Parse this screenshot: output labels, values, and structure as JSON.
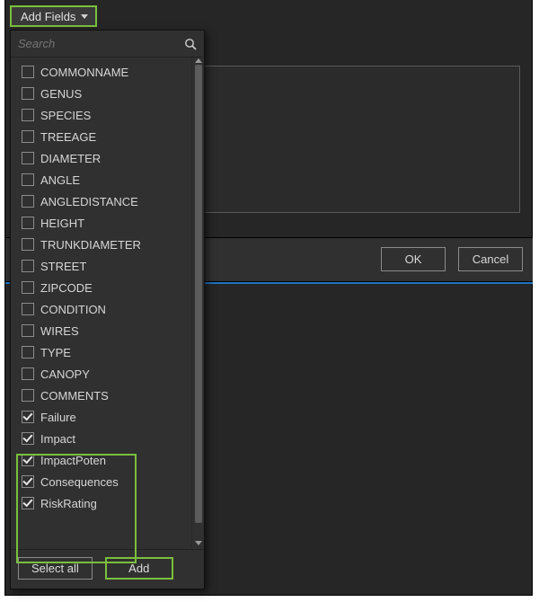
{
  "addFields": {
    "label": "Add Fields"
  },
  "search": {
    "placeholder": "Search"
  },
  "fields": [
    {
      "label": "COMMONNAME",
      "checked": false
    },
    {
      "label": "GENUS",
      "checked": false
    },
    {
      "label": "SPECIES",
      "checked": false
    },
    {
      "label": "TREEAGE",
      "checked": false
    },
    {
      "label": "DIAMETER",
      "checked": false
    },
    {
      "label": "ANGLE",
      "checked": false
    },
    {
      "label": "ANGLEDISTANCE",
      "checked": false
    },
    {
      "label": "HEIGHT",
      "checked": false
    },
    {
      "label": "TRUNKDIAMETER",
      "checked": false
    },
    {
      "label": "STREET",
      "checked": false
    },
    {
      "label": "ZIPCODE",
      "checked": false
    },
    {
      "label": "CONDITION",
      "checked": false
    },
    {
      "label": "WIRES",
      "checked": false
    },
    {
      "label": "TYPE",
      "checked": false
    },
    {
      "label": "CANOPY",
      "checked": false
    },
    {
      "label": "COMMENTS",
      "checked": false
    },
    {
      "label": "Failure",
      "checked": true
    },
    {
      "label": "Impact",
      "checked": true
    },
    {
      "label": "ImpactPoten",
      "checked": true
    },
    {
      "label": "Consequences",
      "checked": true
    },
    {
      "label": "RiskRating",
      "checked": true
    }
  ],
  "footer": {
    "selectAll": "Select all",
    "add": "Add"
  },
  "dialog": {
    "ok": "OK",
    "cancel": "Cancel"
  }
}
